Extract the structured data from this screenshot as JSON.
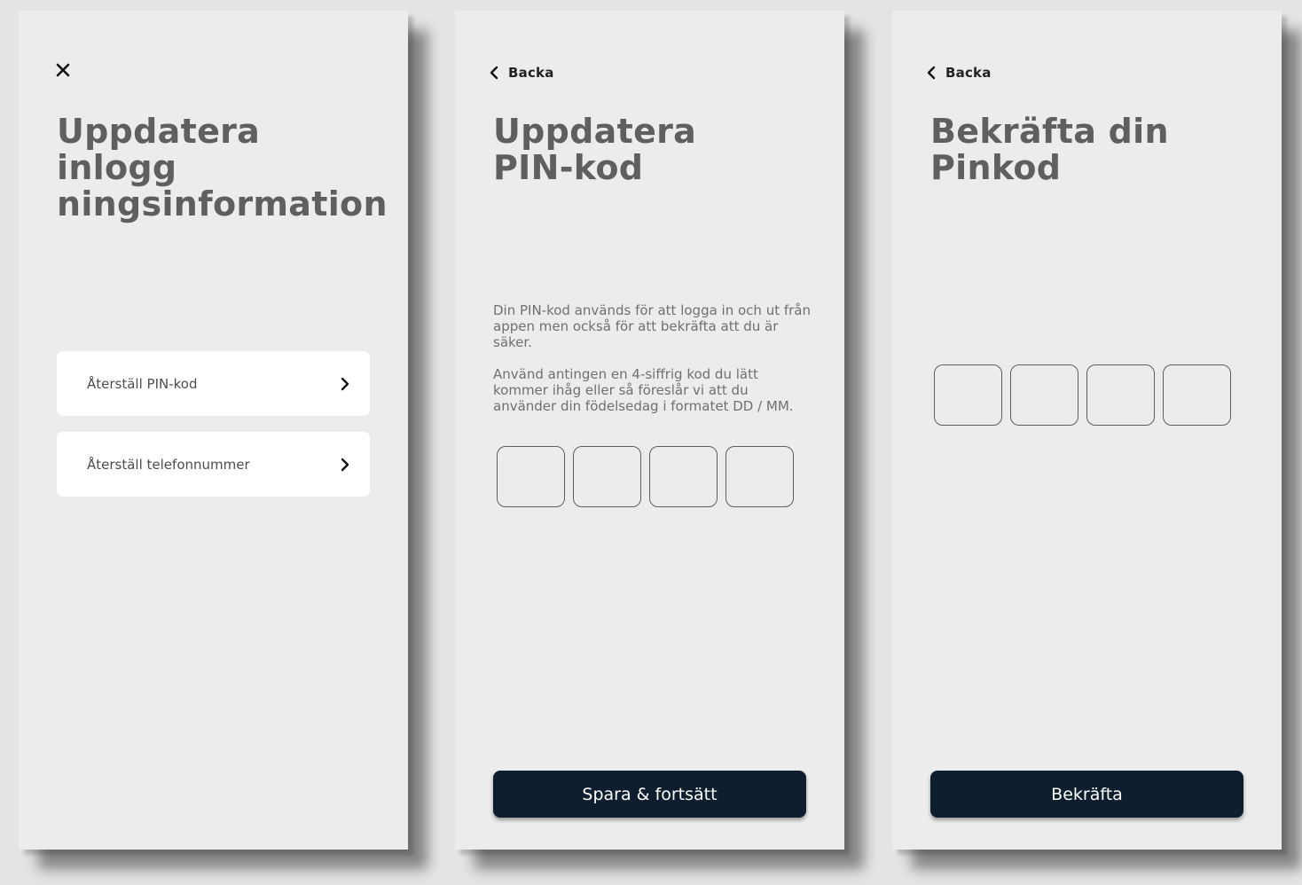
{
  "screens": [
    {
      "nav": {
        "type": "close",
        "icon": "close-icon"
      },
      "title": "Uppdatera inlogg\nningsinformation",
      "items": [
        {
          "label": "Återställ PIN-kod",
          "icon": "chevron-right-icon"
        },
        {
          "label": "Återställ telefonnummer",
          "icon": "chevron-right-icon"
        }
      ]
    },
    {
      "nav": {
        "type": "back",
        "icon": "chevron-left-icon",
        "label": "Backa"
      },
      "title": "Uppdatera\nPIN-kod",
      "description": [
        "Din PIN-kod används för att logga in och ut från appen men också för att bekräfta att du är säker.",
        "Använd antingen en 4-siffrig kod du lätt kommer ihåg eller så föreslår vi att du använder din födelsedag i formatet DD / MM."
      ],
      "pin_digits": 4,
      "button_label": "Spara & fortsätt"
    },
    {
      "nav": {
        "type": "back",
        "icon": "chevron-left-icon",
        "label": "Backa"
      },
      "title": "Bekräfta din\nPinkod",
      "pin_digits": 4,
      "button_label": "Bekräfta"
    }
  ],
  "colors": {
    "screen_background": "#ececec",
    "card_background": "#ffffff",
    "title_text": "#5f5f5f",
    "primary_button": "#0f1e2e",
    "primary_button_text": "#ffffff"
  }
}
